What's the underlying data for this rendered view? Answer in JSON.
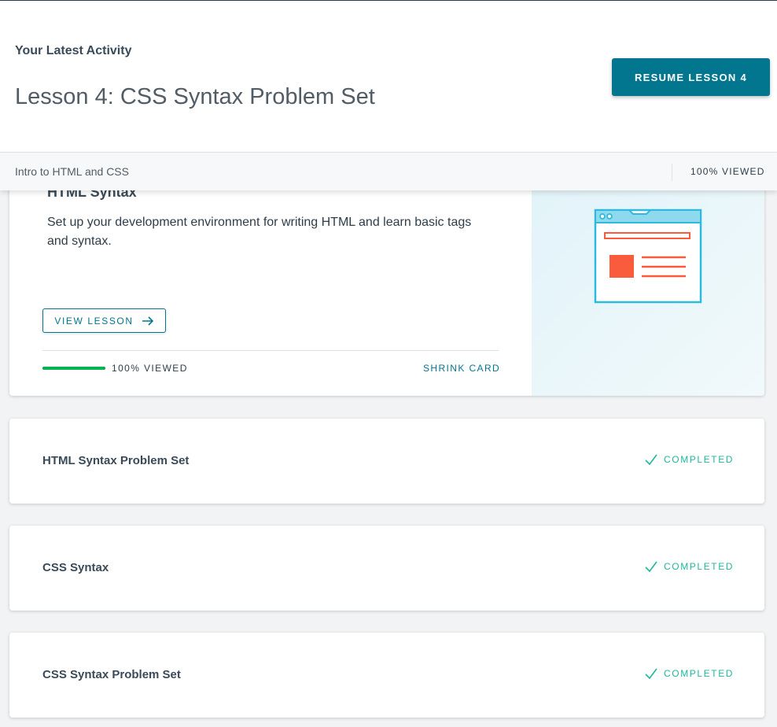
{
  "header": {
    "latest_label": "Your Latest Activity",
    "lesson_title": "Lesson 4: CSS Syntax Problem Set",
    "resume_button": "RESUME LESSON 4"
  },
  "subbar": {
    "course_name": "Intro to HTML and CSS",
    "viewed": "100% VIEWED"
  },
  "expanded_card": {
    "title": "HTML Syntax",
    "description": "Set up your development environment for writing HTML and learn basic tags and syntax.",
    "view_button": "VIEW LESSON",
    "progress": 1.0,
    "viewed": "100% VIEWED",
    "shrink": "SHRINK CARD",
    "illustration": "browser-window-illustration"
  },
  "lessons": [
    {
      "title": "HTML Syntax Problem Set",
      "status": "COMPLETED",
      "icon": "check-icon"
    },
    {
      "title": "CSS Syntax",
      "status": "COMPLETED",
      "icon": "check-icon"
    },
    {
      "title": "CSS Syntax Problem Set",
      "status": "COMPLETED",
      "icon": "check-icon"
    }
  ],
  "colors": {
    "accent": "#02768e",
    "progress": "#02b351",
    "completed": "#1fb89f",
    "illustration_orange": "#f95c3c",
    "illustration_blue": "#2dbadd"
  }
}
